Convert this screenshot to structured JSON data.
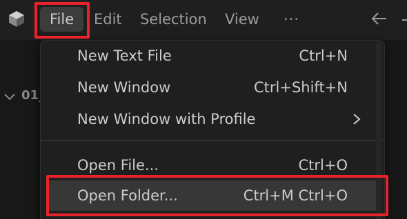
{
  "menubar": {
    "file": "File",
    "edit": "Edit",
    "selection": "Selection",
    "view": "View",
    "more": "···"
  },
  "explorer": {
    "folder_prefix": "01_"
  },
  "file_menu": {
    "items": [
      {
        "label": "New Text File",
        "shortcut": "Ctrl+N"
      },
      {
        "label": "New Window",
        "shortcut": "Ctrl+Shift+N"
      },
      {
        "label": "New Window with Profile",
        "shortcut": ""
      },
      {
        "label": "Open File...",
        "shortcut": "Ctrl+O"
      },
      {
        "label": "Open Folder...",
        "shortcut": "Ctrl+M Ctrl+O"
      }
    ]
  },
  "icons": {
    "logo": "app-logo-icon",
    "back": "arrow-left-icon",
    "chevron_down": "chevron-down-icon",
    "submenu": "chevron-right-icon"
  },
  "colors": {
    "highlight": "#e8232b",
    "menu_bg": "#1f1f1f",
    "active_menu_bg": "#3c3c3c",
    "hover_row_bg": "#373737",
    "text": "#cccccc",
    "muted_text": "#9d9d9d"
  }
}
